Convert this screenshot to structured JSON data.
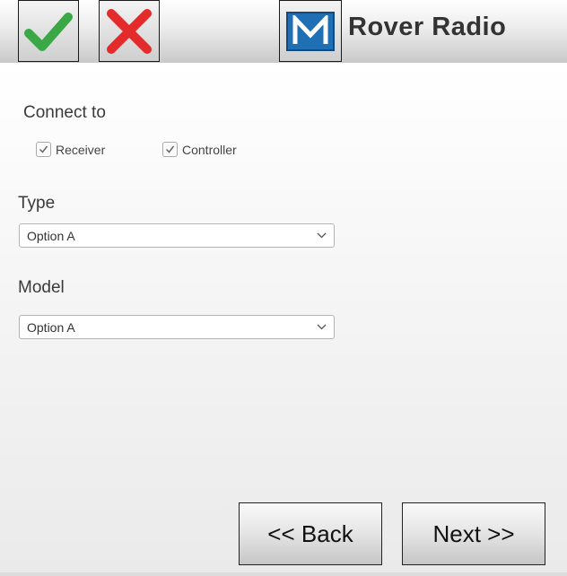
{
  "header": {
    "title": "Rover Radio",
    "logo_letter": "M",
    "ok_icon": "check-icon",
    "cancel_icon": "cross-icon",
    "colors": {
      "check": "#3aa845",
      "cross": "#e32b2b",
      "logo_blue": "#1f6fb5"
    }
  },
  "connect": {
    "label": "Connect to",
    "options": [
      {
        "label": "Receiver",
        "checked": true
      },
      {
        "label": "Controller",
        "checked": true
      }
    ]
  },
  "type_field": {
    "label": "Type",
    "selected": "Option A"
  },
  "model_field": {
    "label": "Model",
    "selected": "Option A"
  },
  "footer": {
    "back_label": "<< Back",
    "next_label": "Next >>"
  }
}
